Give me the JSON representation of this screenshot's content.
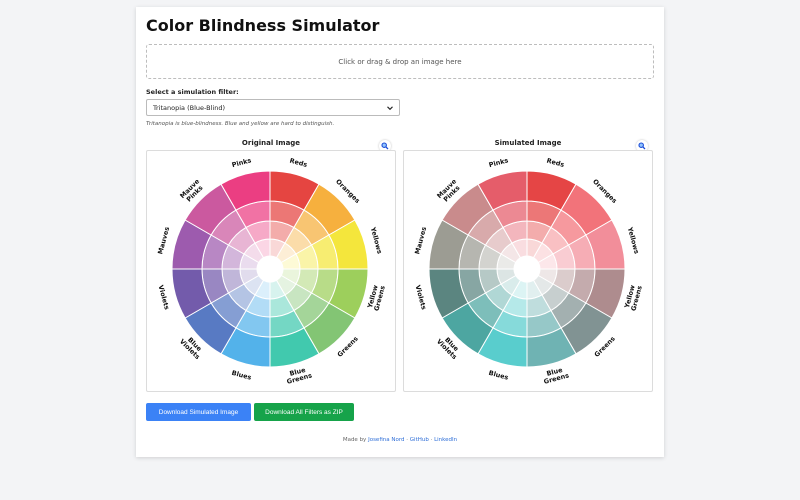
{
  "app": {
    "title": "Color Blindness Simulator"
  },
  "upload": {
    "prompt": "Click or drag & drop an image here"
  },
  "filter": {
    "label": "Select a simulation filter:",
    "selected": "Tritanopia (Blue-Blind)",
    "description": "Tritanopia is blue-blindness. Blue and yellow are hard to distinguish."
  },
  "panels": {
    "original_title": "Original Image",
    "simulated_title": "Simulated Image"
  },
  "icons": {
    "zoom": "magnifier-icon",
    "dropdown": "chevron-down-icon"
  },
  "wheel": {
    "segments": [
      {
        "label": "Reds",
        "base": "#e02420",
        "sim": "#e02424"
      },
      {
        "label": "Oranges",
        "base": "#f4a21c",
        "sim": "#f05a62"
      },
      {
        "label": "Yellows",
        "base": "#f2e21a",
        "sim": "#f07a88"
      },
      {
        "label": "Yellow Greens",
        "base": "#8cc63f",
        "sim": "#a0787a"
      },
      {
        "label": "Greens",
        "base": "#6dbb5b",
        "sim": "#6b8080"
      },
      {
        "label": "Blue Greens",
        "base": "#1fbfa0",
        "sim": "#56a6a6"
      },
      {
        "label": "Blues",
        "base": "#35a4e6",
        "sim": "#3cc4c4"
      },
      {
        "label": "Blue Violets",
        "base": "#3a63b8",
        "sim": "#2e9690"
      },
      {
        "label": "Violets",
        "base": "#5a3e9c",
        "sim": "#3e706a"
      },
      {
        "label": "Mauves",
        "base": "#8c3ea0",
        "sim": "#8a8a80"
      },
      {
        "label": "Mauve Pinks",
        "base": "#c23c8e",
        "sim": "#c07678"
      },
      {
        "label": "Pinks",
        "base": "#e81c6c",
        "sim": "#e04050"
      }
    ]
  },
  "buttons": {
    "download_simulated": "Download Simulated Image",
    "download_zip": "Download All Filters as ZIP"
  },
  "footer": {
    "prefix": "Made by",
    "author": "Josefina Nord",
    "sep1": "·",
    "github": "GitHub",
    "sep2": "·",
    "linkedin": "LinkedIn"
  },
  "colors": {
    "primary_button": "#3b82f6",
    "success_button": "#16a34a",
    "link": "#2f6fd8"
  }
}
